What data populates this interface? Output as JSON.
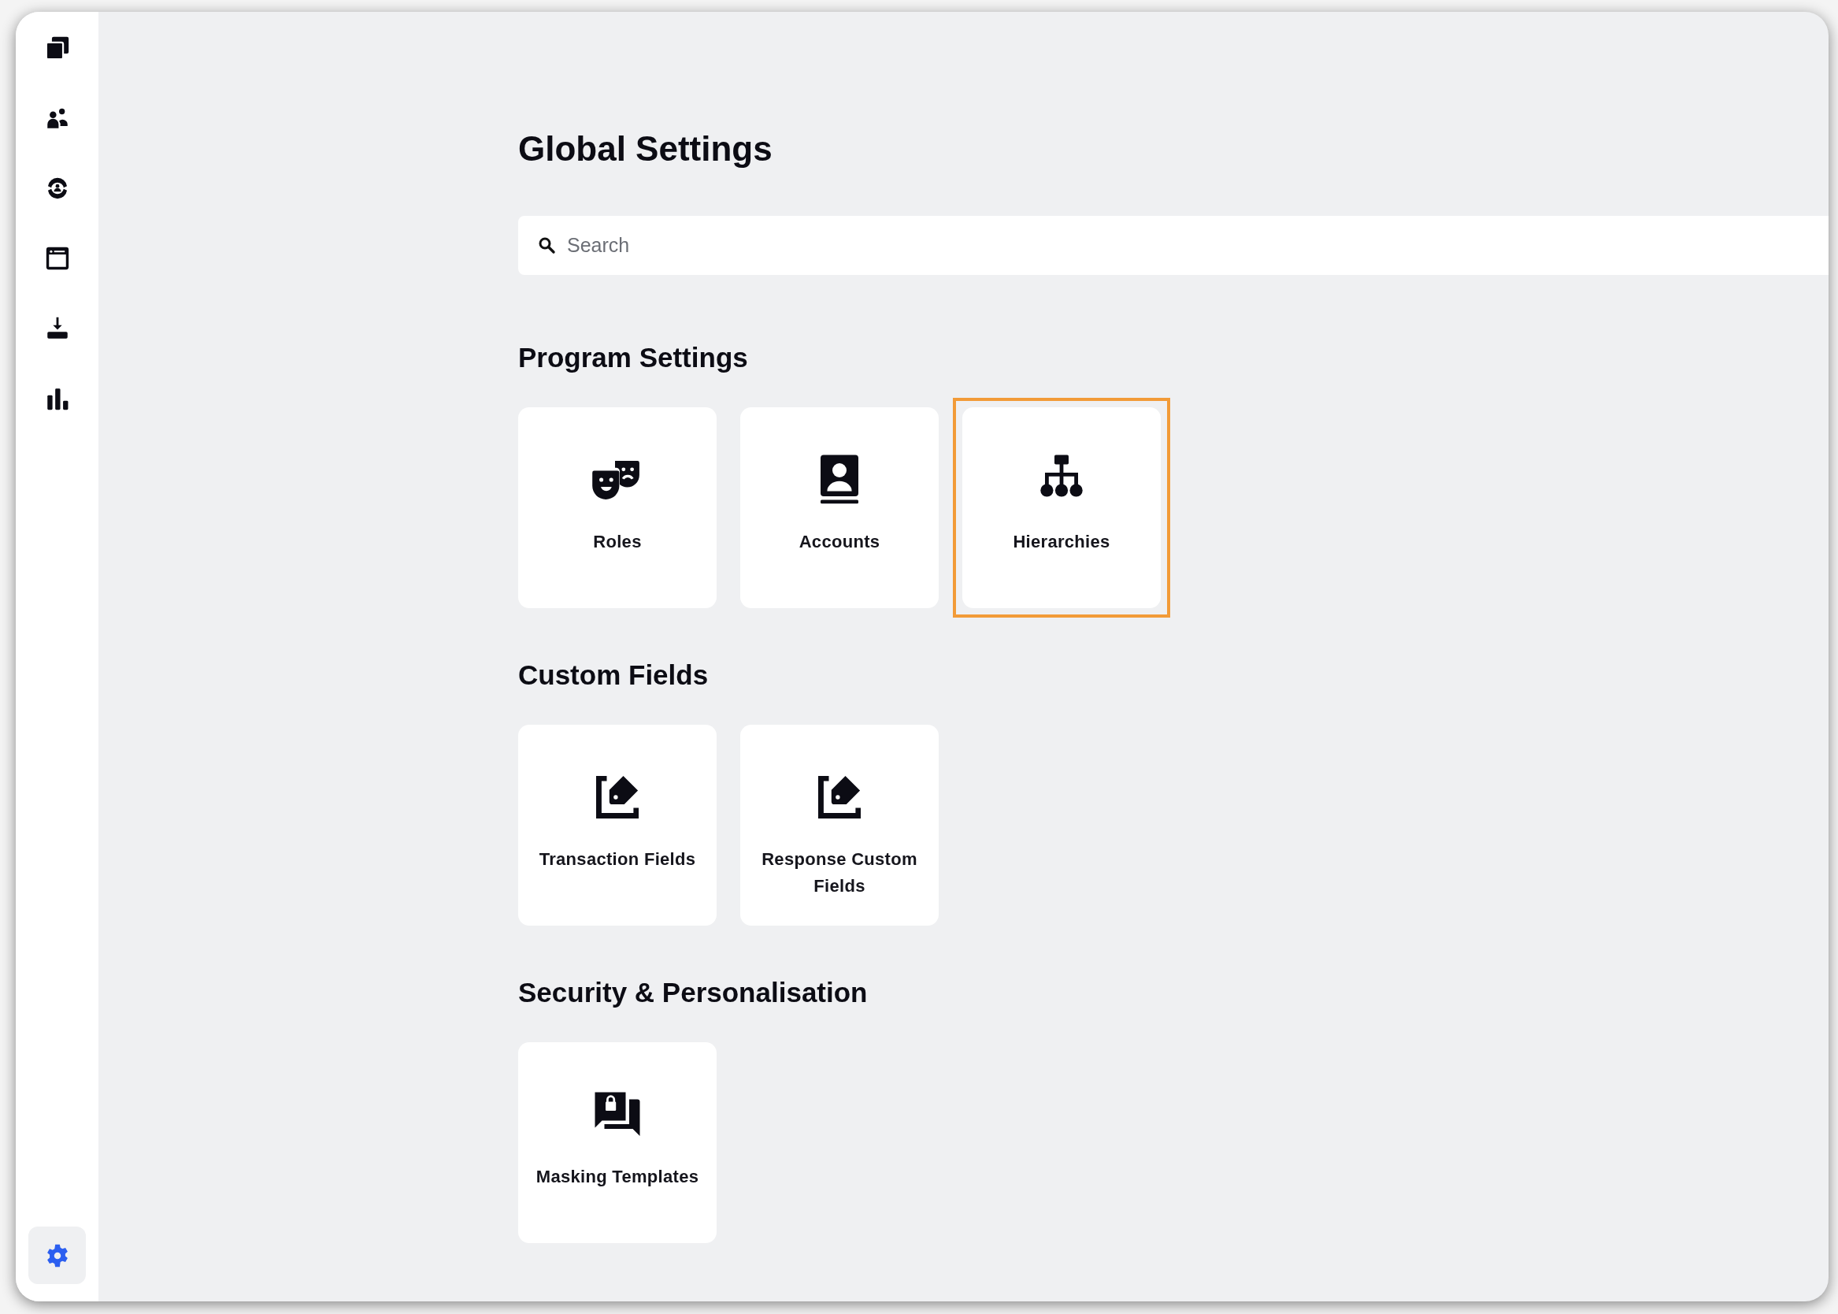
{
  "sidebar": {
    "items": [
      {
        "selected": false
      },
      {
        "selected": false
      },
      {
        "selected": false
      },
      {
        "selected": false
      },
      {
        "selected": false
      },
      {
        "selected": false
      }
    ],
    "footer_items": [
      {
        "selected": true
      }
    ]
  },
  "page": {
    "title": "Global Settings",
    "search": {
      "placeholder": "Search"
    }
  },
  "sections": [
    {
      "title": "Program Settings",
      "cards": [
        {
          "label": "Roles",
          "selected": false
        },
        {
          "label": "Accounts",
          "selected": false
        },
        {
          "label": "Hierarchies",
          "selected": true
        }
      ]
    },
    {
      "title": "Custom Fields",
      "cards": [
        {
          "label": "Transaction Fields",
          "selected": false
        },
        {
          "label": "Response Custom Fields",
          "selected": false
        }
      ]
    },
    {
      "title": "Security & Personalisation",
      "cards": [
        {
          "label": "Masking Templates",
          "selected": false
        }
      ]
    }
  ]
}
